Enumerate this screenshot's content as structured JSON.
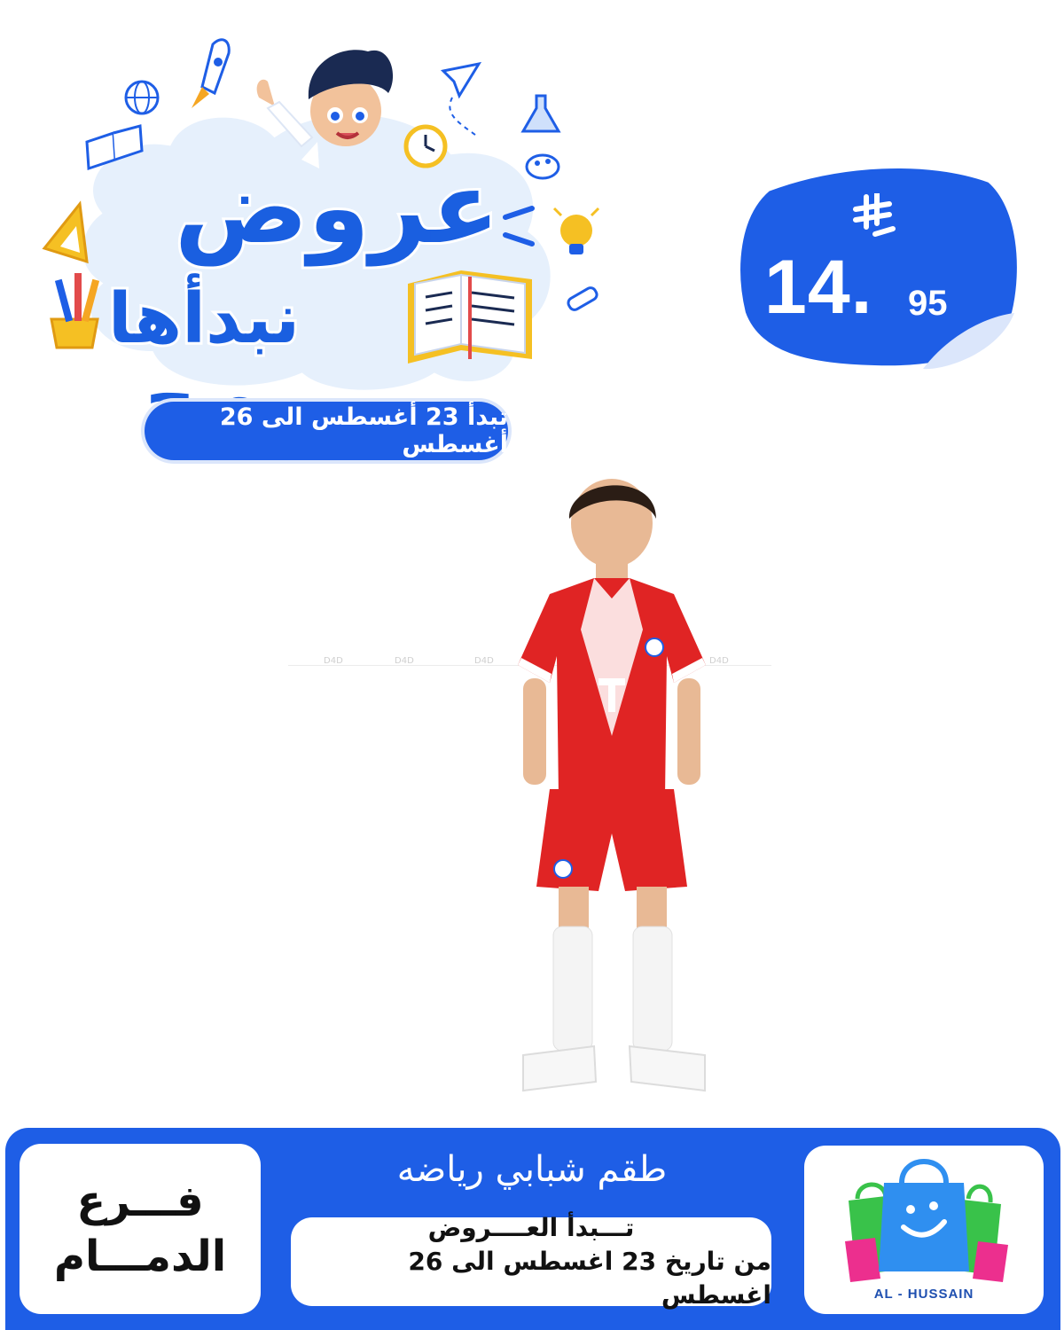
{
  "campaign": {
    "title_line1": "عروض",
    "title_line2": "نبدأها صح",
    "date_range": "تبدأ 23 أغسطس الى 26 أغسطس"
  },
  "price": {
    "currency_icon": "saudi-riyal-symbol-icon",
    "amount": "14.",
    "cents": "95"
  },
  "product": {
    "name": "طقم شبابي رياضه",
    "watermark": "D4D"
  },
  "offer": {
    "line1": "تـــبدأ العــــروض",
    "line2": "من تاريخ 23 اغسطس الى 26 اغسطس"
  },
  "branch": {
    "line1": "فـــرع",
    "line2": "الدمـــام"
  },
  "brand": {
    "name": "AL - HUSSAIN"
  },
  "colors": {
    "primary_blue": "#1e5ee6",
    "white": "#ffffff",
    "jersey_red": "#e02424"
  }
}
